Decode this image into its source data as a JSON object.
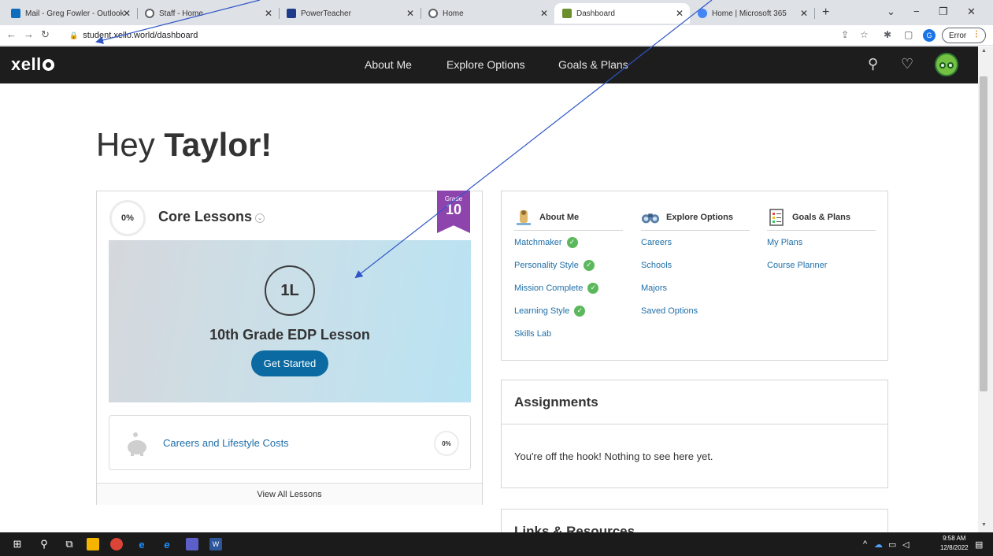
{
  "browser": {
    "tabs": [
      {
        "label": "Mail - Greg Fowler - Outlook",
        "color": "#0f6cbd"
      },
      {
        "label": "Staff - Home",
        "color": "#5f6368"
      },
      {
        "label": "PowerTeacher",
        "color": "#1e3a8a"
      },
      {
        "label": "Home",
        "color": "#5f6368"
      },
      {
        "label": "Dashboard",
        "color": "#6c8f2e"
      },
      {
        "label": "Home | Microsoft 365",
        "color": "#4285f4"
      }
    ],
    "new_tab": "+",
    "url": "student.xello.world/dashboard",
    "profile_initial": "G",
    "error_label": "Error"
  },
  "xello": {
    "logo": "xell",
    "nav": [
      "About Me",
      "Explore Options",
      "Goals & Plans"
    ]
  },
  "greeting": {
    "prefix": "Hey ",
    "name": "Taylor!"
  },
  "lessons": {
    "progress": "0%",
    "title": "Core Lessons",
    "grade_label": "Grade",
    "grade_number": "10",
    "badge": "1L",
    "lesson_name": "10th Grade EDP Lesson",
    "cta": "Get Started",
    "secondary": {
      "label": "Careers and Lifestyle Costs",
      "progress": "0%"
    },
    "view_all": "View All Lessons"
  },
  "menu": {
    "columns": [
      {
        "title": "About Me",
        "icon": "explorer-icon",
        "links": [
          {
            "label": "Matchmaker",
            "done": true
          },
          {
            "label": "Personality Style",
            "done": true
          },
          {
            "label": "Mission Complete",
            "done": true
          },
          {
            "label": "Learning Style",
            "done": true
          },
          {
            "label": "Skills Lab",
            "done": false
          }
        ]
      },
      {
        "title": "Explore Options",
        "icon": "binoculars-icon",
        "links": [
          {
            "label": "Careers",
            "done": false
          },
          {
            "label": "Schools",
            "done": false
          },
          {
            "label": "Majors",
            "done": false
          },
          {
            "label": "Saved Options",
            "done": false
          }
        ]
      },
      {
        "title": "Goals & Plans",
        "icon": "checklist-icon",
        "links": [
          {
            "label": "My Plans",
            "done": false
          },
          {
            "label": "Course Planner",
            "done": false
          }
        ]
      }
    ]
  },
  "assignments": {
    "title": "Assignments",
    "empty": "You're off the hook! Nothing to see here yet."
  },
  "links": {
    "title": "Links & Resources"
  },
  "taskbar": {
    "time": "9:58 AM",
    "date": "12/8/2022"
  },
  "colors": {
    "accent": "#0a6aa1",
    "grade": "#8e44ad",
    "header": "#1d1d1d",
    "arrow": "#2f55c8"
  }
}
